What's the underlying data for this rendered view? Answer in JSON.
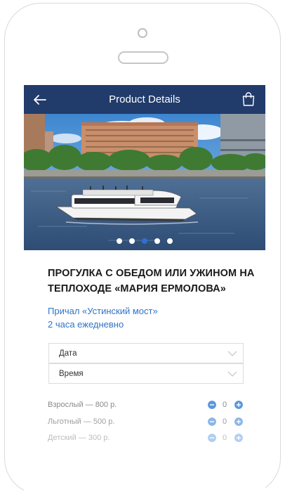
{
  "navbar": {
    "title": "Product Details",
    "back_icon": "arrow-left-icon",
    "bag_icon": "shopping-bag-icon",
    "background": "#213b6b"
  },
  "gallery": {
    "slide_count": 5,
    "active_slide": 3,
    "dot_active_color": "#2f6fd0"
  },
  "product": {
    "title": "ПРОГУЛКА С ОБЕДОМ ИЛИ УЖИНОМ НА ТЕПЛОХОДЕ «МАРИЯ ЕРМОЛОВА»",
    "pier": "Причал «Устинский мост»",
    "duration": "2 часа ежедневно",
    "accent": "#2f74c9"
  },
  "selects": {
    "date_label": "Дата",
    "time_label": "Время"
  },
  "prices": [
    {
      "label": "Взрослый — 800 р.",
      "qty": "0"
    },
    {
      "label": "Льготный — 500 р.",
      "qty": "0"
    },
    {
      "label": "Детский — 300 р.",
      "qty": "0"
    }
  ]
}
